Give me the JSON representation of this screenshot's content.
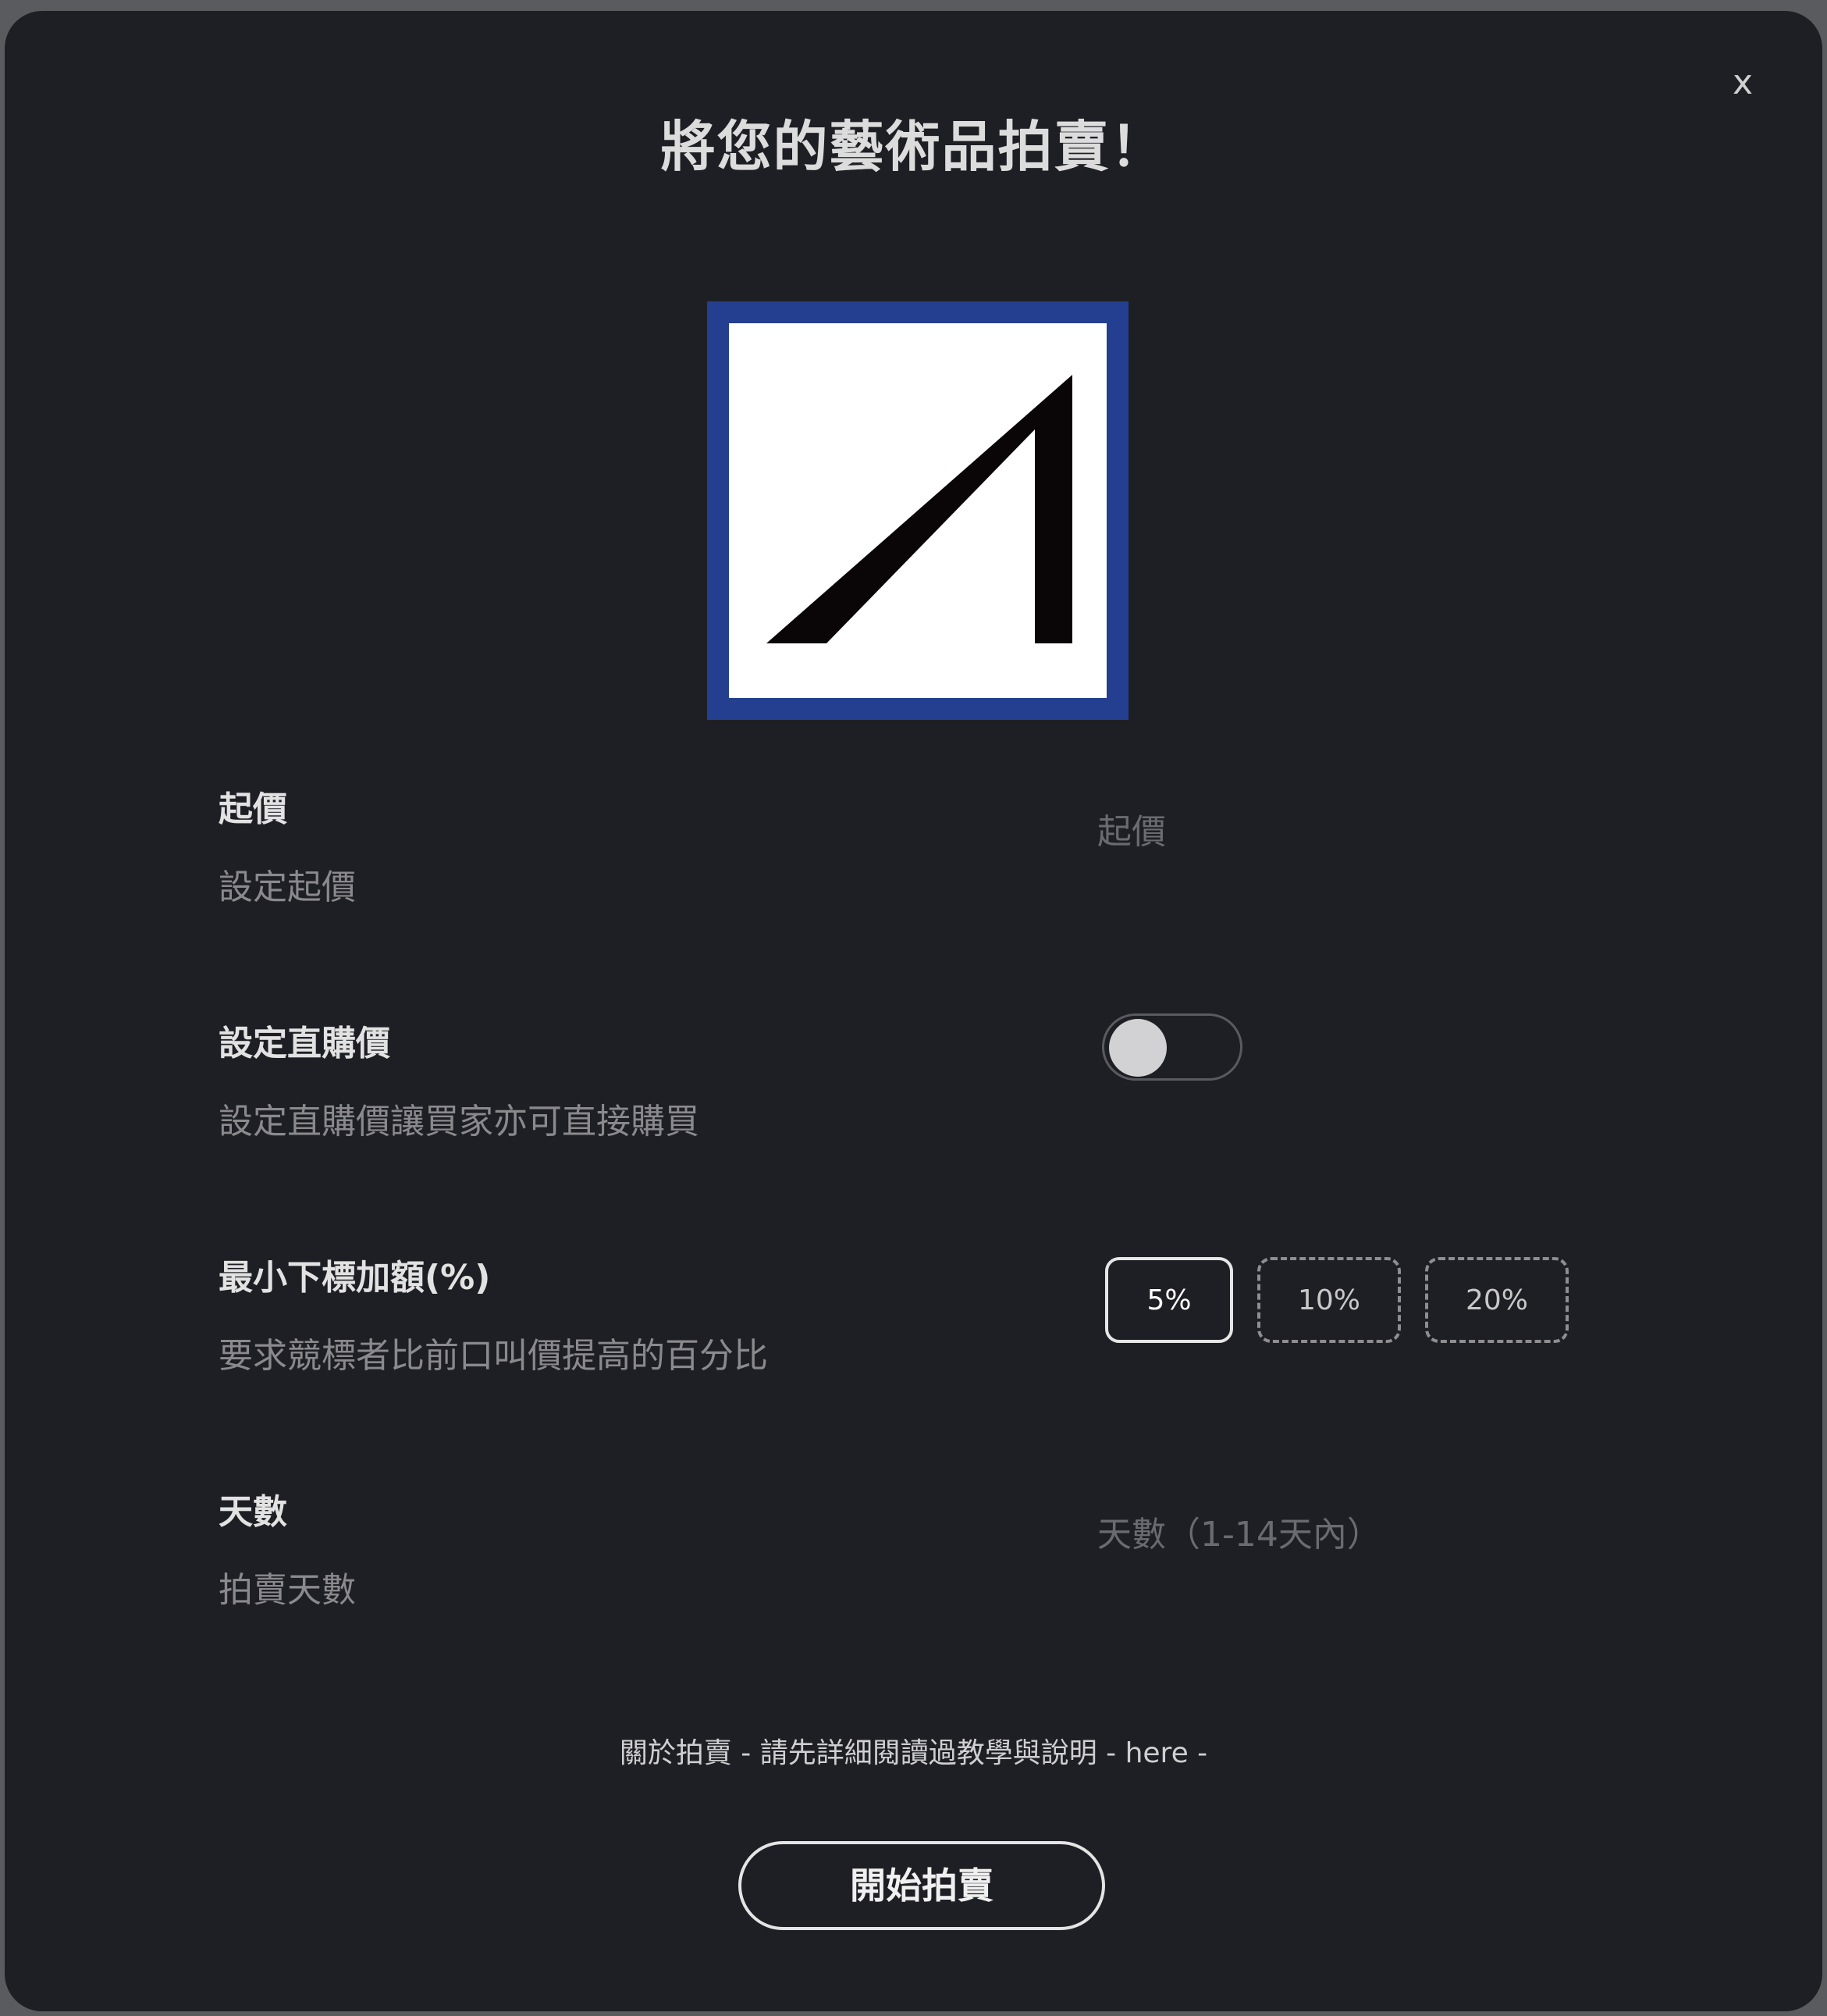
{
  "dialog": {
    "title": "將您的藝術品拍賣！",
    "close_label": "x"
  },
  "artwork": {
    "frame_color": "#243f8f"
  },
  "starting_price": {
    "label": "起價",
    "description": "設定起價",
    "placeholder": "起價"
  },
  "buy_now": {
    "label": "設定直購價",
    "description": "設定直購價讓買家亦可直接購買",
    "enabled": false
  },
  "min_increment": {
    "label": "最小下標加額(%)",
    "description": "要求競標者比前口叫價提高的百分比",
    "options": [
      "5%",
      "10%",
      "20%"
    ],
    "selected": "5%"
  },
  "days": {
    "label": "天數",
    "description": "拍賣天數",
    "placeholder": "天數（1-14天內）"
  },
  "info": {
    "text": "關於拍賣 - 請先詳細閱讀過教學與說明 - ",
    "link_text": "here",
    "suffix": " -"
  },
  "actions": {
    "start_label": "開始拍賣"
  },
  "colors": {
    "background": "#1e1f24",
    "text": "#e2e2e2",
    "muted": "#8a8a8e"
  }
}
